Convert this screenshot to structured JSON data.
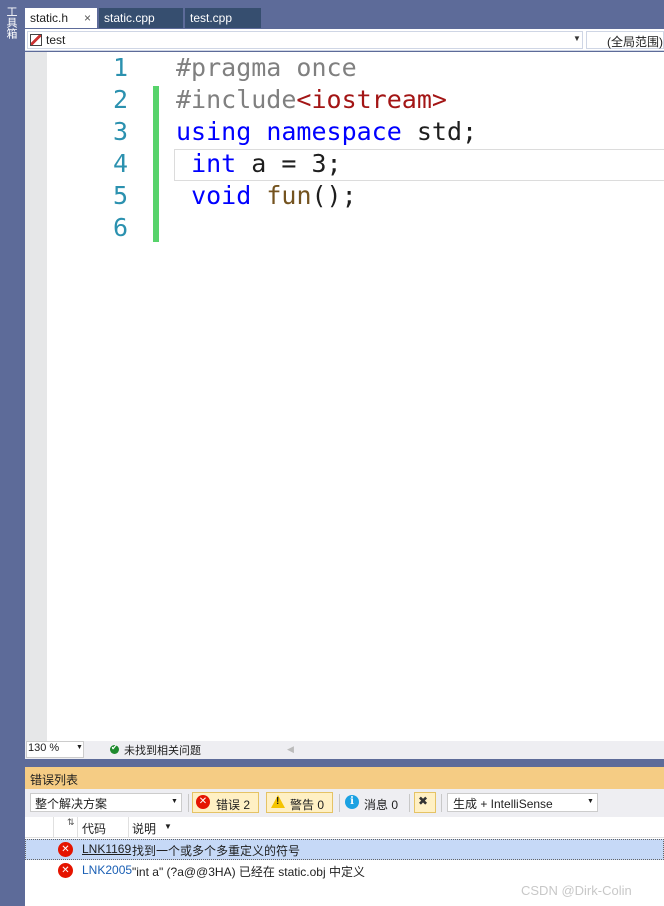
{
  "toolbox": {
    "label": "工具箱"
  },
  "tabs": [
    {
      "label": "static.h",
      "active": true,
      "close_glyph": "×"
    },
    {
      "label": "static.cpp",
      "active": false
    },
    {
      "label": "test.cpp",
      "active": false
    }
  ],
  "navbar": {
    "project": "test",
    "scope": "(全局范围)"
  },
  "editor": {
    "line_numbers": [
      "1",
      "2",
      "3",
      "4",
      "5",
      "6"
    ],
    "lines": [
      [
        {
          "t": "#pragma once",
          "c": "pp"
        }
      ],
      [
        {
          "t": "#include",
          "c": "pp"
        },
        {
          "t": "<iostream>",
          "c": "str"
        }
      ],
      [
        {
          "t": "using",
          "c": "kw"
        },
        {
          "t": " "
        },
        {
          "t": "namespace",
          "c": "kw"
        },
        {
          "t": " std;"
        }
      ],
      [
        {
          "t": " "
        },
        {
          "t": "int",
          "c": "kw"
        },
        {
          "t": " a = 3;"
        }
      ],
      [
        {
          "t": " "
        },
        {
          "t": "void",
          "c": "kw"
        },
        {
          "t": " "
        },
        {
          "t": "fun",
          "c": "fn"
        },
        {
          "t": "();"
        }
      ],
      []
    ],
    "changed_lines": [
      2,
      6
    ],
    "current_line": 4
  },
  "status": {
    "zoom": "130 %",
    "issues_text": "未找到相关问题"
  },
  "error_list": {
    "title": "错误列表",
    "scope": "整个解决方案",
    "errors_label": "错误 2",
    "warnings_label": "警告 0",
    "messages_label": "消息 0",
    "source": "生成 + IntelliSense",
    "columns": {
      "code": "代码",
      "description": "说明"
    },
    "rows": [
      {
        "code": "LNK1169",
        "description": "找到一个或多个多重定义的符号",
        "selected": true
      },
      {
        "code": "LNK2005",
        "description": "\"int a\" (?a@@3HA) 已经在 static.obj 中定义",
        "selected": false
      }
    ]
  },
  "watermark": "CSDN @Dirk-Colin",
  "colors": {
    "frame": "#5d6b99",
    "error_list_title": "#f5cc84",
    "keyword": "#0000ff",
    "preprocessor": "#808080",
    "string": "#a31515",
    "function": "#74531f",
    "line_number": "#2b91af",
    "change_marker": "#57d36b",
    "error_icon": "#e51400"
  }
}
